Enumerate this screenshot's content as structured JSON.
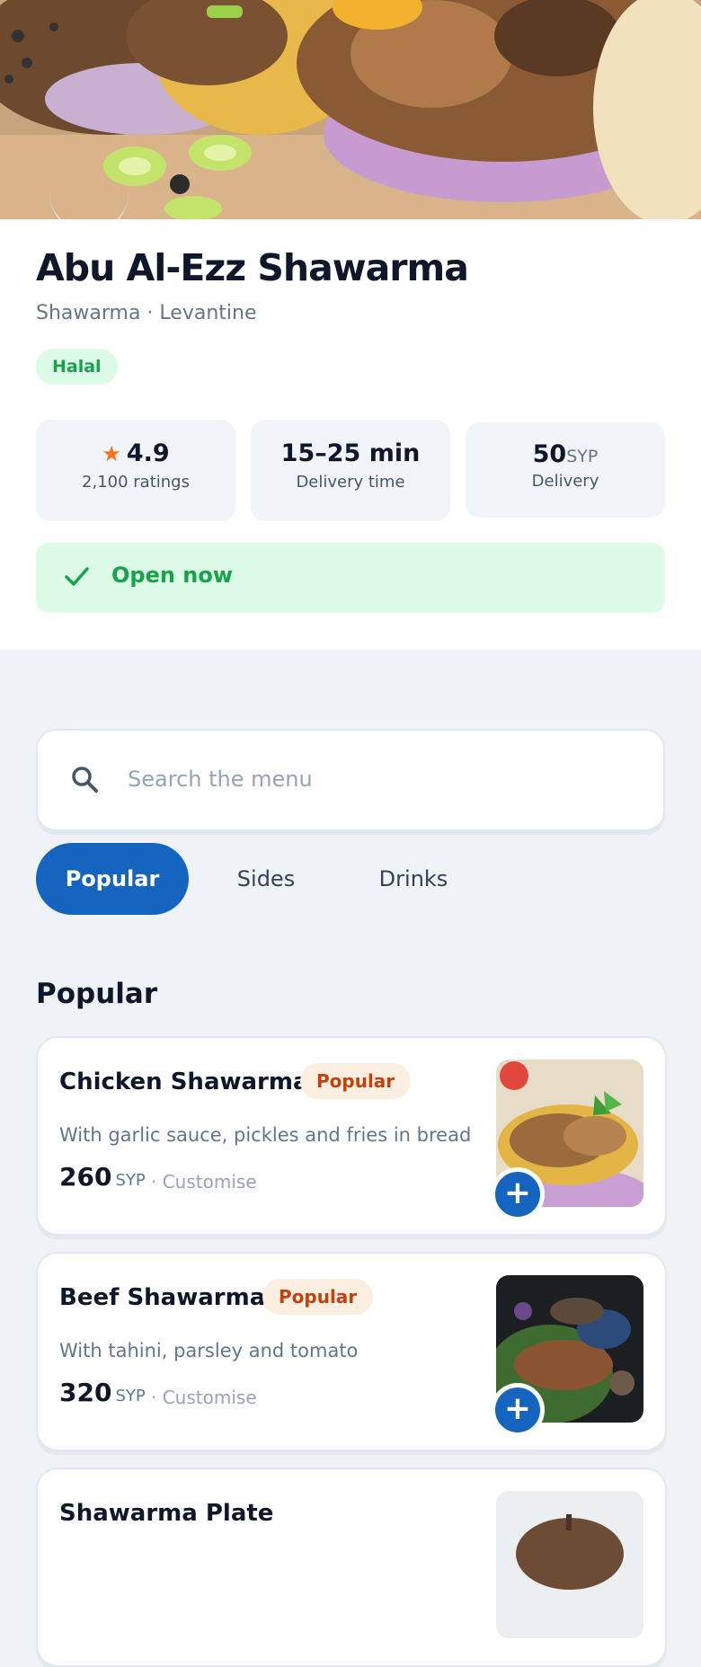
{
  "restaurant": {
    "name": "Abu Al-Ezz Shawarma",
    "cuisine": "Shawarma · Levantine",
    "badge": "Halal"
  },
  "stats": {
    "rating": "4.9",
    "ratings_count": "2,100 ratings",
    "delivery_time": "15–25 min",
    "delivery_time_label": "Delivery time",
    "delivery_fee": "50",
    "delivery_fee_currency": "SYP",
    "delivery_fee_label": "Delivery"
  },
  "status": {
    "label": "Open now"
  },
  "search": {
    "placeholder": "Search the menu"
  },
  "tabs": [
    {
      "label": "Popular",
      "active": true
    },
    {
      "label": "Sides",
      "active": false
    },
    {
      "label": "Drinks",
      "active": false
    }
  ],
  "section": {
    "title": "Popular"
  },
  "menu": [
    {
      "name": "Chicken Shawarma",
      "badge": "Popular",
      "description": "With garlic sauce, pickles and fries in bread",
      "price": "260",
      "currency": "SYP",
      "customise": "· Customise",
      "add": "+"
    },
    {
      "name": "Beef Shawarma",
      "badge": "Popular",
      "description": "With tahini, parsley and tomato",
      "price": "320",
      "currency": "SYP",
      "customise": "· Customise",
      "add": "+"
    },
    {
      "name": "Shawarma Plate"
    }
  ],
  "colors": {
    "primary": "#1565c0",
    "success": "#16a34a",
    "success_bg": "#dcfce7",
    "popular": "#c2410c",
    "popular_bg": "#fdeee2",
    "star": "#f97316",
    "page_bg": "#eff3f8"
  },
  "icons": {
    "rating": "star-icon",
    "status": "check-icon",
    "search": "search-icon",
    "add": "plus-icon"
  }
}
